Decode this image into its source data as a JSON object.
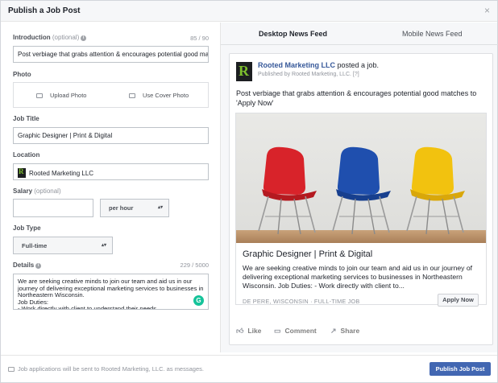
{
  "dialog": {
    "title": "Publish a Job Post",
    "close_glyph": "×"
  },
  "form": {
    "intro": {
      "label": "Introduction",
      "optional": "(optional)",
      "count": "85 / 90",
      "value": "Post verbiage that grabs attention & encourages potential good matches to 'Apply Now'"
    },
    "photo": {
      "label": "Photo",
      "upload": "Upload Photo",
      "cover": "Use Cover Photo"
    },
    "job_title": {
      "label": "Job Title",
      "value": "Graphic Designer | Print & Digital"
    },
    "location": {
      "label": "Location",
      "value": "Rooted Marketing LLC"
    },
    "salary": {
      "label": "Salary",
      "optional": "(optional)",
      "value": "",
      "period": "per hour"
    },
    "job_type": {
      "label": "Job Type",
      "value": "Full-time"
    },
    "details": {
      "label": "Details",
      "count": "229 / 5000",
      "value": "We are seeking creative minds to join our team and aid us in our journey of delivering exceptional marketing services to businesses in Northeastern Wisconsin.\nJob Duties:\n- Work directly with client to understand their needs"
    }
  },
  "preview": {
    "tabs": [
      "Desktop News Feed",
      "Mobile News Feed"
    ],
    "page_name": "Rooted Marketing LLC",
    "posted_text": " posted a job.",
    "published_by": "Published by Rooted Marketing, LLC. [?]",
    "post_text": "Post verbiage that grabs attention & encourages potential good matches to 'Apply Now'",
    "job_title": "Graphic Designer | Print & Digital",
    "job_desc": "We are seeking creative minds to join our team and aid us in our journey of delivering exceptional marketing services to businesses in Northeastern Wisconsin. Job Duties: - Work directly with client to...",
    "meta": "DE PERE, WISCONSIN · FULL-TIME JOB",
    "apply_label": "Apply Now",
    "actions": {
      "like": "Like",
      "comment": "Comment",
      "share": "Share"
    }
  },
  "footer": {
    "note": "Job applications will be sent to Rooted Marketing, LLC. as messages.",
    "publish_label": "Publish Job Post"
  },
  "colors": {
    "accent": "#4267b2",
    "link": "#365899",
    "chair_red": "#d8232a",
    "chair_blue": "#1f4fae",
    "chair_yellow": "#f2c20f"
  }
}
